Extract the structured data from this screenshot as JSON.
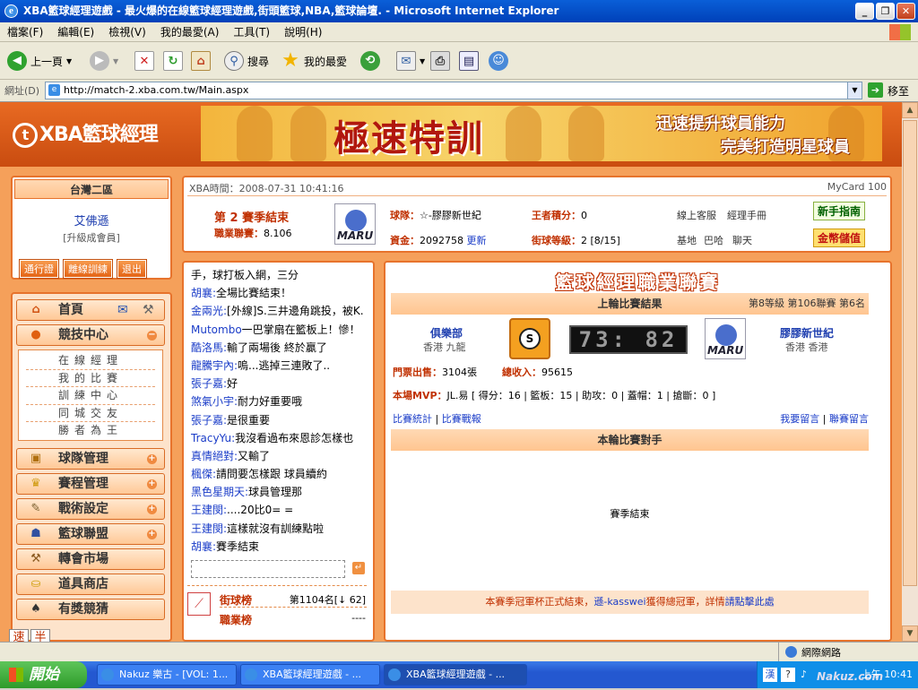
{
  "window": {
    "title": "XBA籃球經理遊戲 - 最火爆的在線籃球經理遊戲,街頭籃球,NBA,籃球論壇. - Microsoft Internet Explorer",
    "icon": "ie-icon"
  },
  "menu": [
    "檔案(F)",
    "編輯(E)",
    "檢視(V)",
    "我的最愛(A)",
    "工具(T)",
    "說明(H)"
  ],
  "toolbar": {
    "back": "上一頁",
    "search": "搜尋",
    "favorites": "我的最愛"
  },
  "address": {
    "label": "網址(D)",
    "url": "http://match-2.xba.com.tw/Main.aspx",
    "go": "移至"
  },
  "site": {
    "logo": "XBA籃球經理",
    "ad": {
      "headline": "極速特訓",
      "line1": "迅速提升球員能力",
      "line2": "完美打造明星球員"
    }
  },
  "user": {
    "region": "台灣二區",
    "name": "艾佛遜",
    "level": "[升級成會員]",
    "buttons": [
      "通行證",
      "離線訓練",
      "退出"
    ]
  },
  "nav": {
    "home": "首頁",
    "compete": "競技中心",
    "sub": [
      "在線經理",
      "我的比賽",
      "訓練中心",
      "同城交友",
      "勝者為王"
    ],
    "items": [
      "球隊管理",
      "賽程管理",
      "戰術設定",
      "籃球聯盟",
      "轉會市場",
      "道具商店",
      "有獎競猜"
    ]
  },
  "infobar": {
    "time_label": "XBA時間：",
    "time": "2008-07-31 10:41:16",
    "mycard": "MyCard 100",
    "season": "第 2 賽季結束",
    "league_label": "職業聯賽：",
    "league_value": "8.106",
    "team_label": "球隊：",
    "team": "☆-膠膠新世紀",
    "king_label": "王者積分：",
    "king_value": "0",
    "online_service": "線上客服",
    "manual": "經理手冊",
    "funds_label": "資金：",
    "funds": "2092758",
    "update": "更新",
    "street_label": "街球等級：",
    "street_value": "2 [8/15]",
    "base": "基地",
    "bar": "巴哈",
    "chat": "聊天",
    "newbie_btn": "新手指南",
    "gold_btn": "金幣儲值"
  },
  "chat": {
    "lines": [
      {
        "who": "",
        "text": "手，球打板入網，三分",
        "color": "default"
      },
      {
        "who": "胡襄:",
        "text": "全場比賽結束！",
        "color": "default"
      },
      {
        "who": "金兩光:",
        "text": "[外線]S.三井邊角跳投，被K.",
        "color": "default"
      },
      {
        "who": "Mutombo",
        "text": "一巴掌扇在籃板上！慘！",
        "color": "default"
      },
      {
        "who": "酷洛馬:",
        "text": "輸了兩場後 終於贏了",
        "color": "default"
      },
      {
        "who": "龍騰宇內:",
        "text": "嗚...逃掉三連敗了..",
        "color": "default"
      },
      {
        "who": "張子嘉:",
        "text": "好",
        "color": "default"
      },
      {
        "who": "煞氣小宇:",
        "text": "耐力好重要哦",
        "color": "default"
      },
      {
        "who": "張子嘉:",
        "text": "是很重要",
        "color": "default"
      },
      {
        "who": "TracyYu:",
        "text": "我沒看過布來恩診怎樣也",
        "color": "default"
      },
      {
        "who": "真情絕對:",
        "text": "又輸了",
        "color": "default"
      },
      {
        "who": "楓傑:",
        "text": "請問要怎樣跟 球員續約",
        "color": "default"
      },
      {
        "who": "黑色星期天:",
        "text": "球員管理那",
        "color": "default"
      },
      {
        "who": "王建閔:",
        "text": "....20比0= =",
        "color": "default"
      },
      {
        "who": "王建閔:",
        "text": "這樣就沒有訓練點啦",
        "color": "default"
      },
      {
        "who": "胡襄:",
        "text": "賽季結束",
        "color": "default"
      }
    ],
    "input_placeholder": ""
  },
  "ranks": {
    "street_label": "街球榜",
    "street_rank": "第1104名[↓ 62]",
    "pro_label": "職業榜",
    "pro_rank": "----"
  },
  "match": {
    "heading": "籃球經理職業聯賽",
    "last_result": "上輪比賽結果",
    "round_info": "第8等級 第106聯賽 第6名",
    "home_team": "俱樂部",
    "home_loc": "香港 九龍",
    "score": "73: 82",
    "away_team": "膠膠新世紀",
    "away_loc": "香港 香港",
    "tickets_label": "門票出售：",
    "tickets": "3104張",
    "income_label": "總收入：",
    "income": "95615",
    "mvp_label": "本場MVP：",
    "mvp": "JL.易",
    "mvp_stats": "[ 得分：16 | 籃板：15 | 助攻：0 | 蓋帽：1 | 搶斷：0 ]",
    "stats_link": "比賽統計",
    "report_link": "比賽戰報",
    "msg_link": "我要留言",
    "alliance_msg": "聯賽留言",
    "opponent_bar": "本輪比賽對手",
    "season_end": "賽季結束",
    "notice_pre": "本賽季冠軍杯正式結束，",
    "notice_name": "遜-kasswei",
    "notice_mid": "獲得總冠軍，詳情",
    "notice_link": "請點擊此處"
  },
  "bottom_tools": [
    "速",
    "半"
  ],
  "status": {
    "zone": "網際網路"
  },
  "taskbar": {
    "start": "開始",
    "tasks": [
      "Nakuz 樂古 - [VOL: 1...",
      "XBA籃球經理遊戲 - ...",
      "XBA籃球經理遊戲 - ..."
    ],
    "clock": "上午 10:41",
    "watermark": "Nakuz.com"
  }
}
